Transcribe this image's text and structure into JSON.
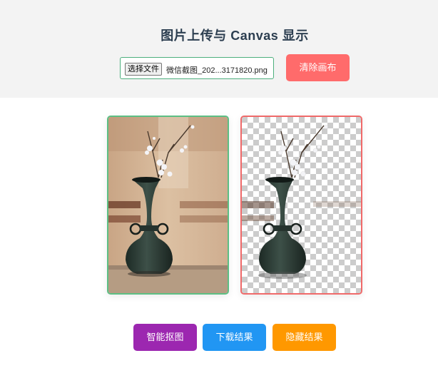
{
  "header": {
    "title": "图片上传与 Canvas 显示",
    "file_button_label": "选择文件",
    "file_name": "微信截图_202...3171820.png",
    "clear_button_label": "清除画布"
  },
  "canvases": {
    "original": {
      "image": "vase-with-branch-photo"
    },
    "result": {
      "image": "vase-with-transparent-background"
    }
  },
  "actions": {
    "matting_label": "智能抠图",
    "download_label": "下载结果",
    "hide_label": "隐藏结果"
  },
  "colors": {
    "file_border": "#4caf7d",
    "clear": "#ff6b6b",
    "original_border": "#5cbf84",
    "result_border": "#f06a6a",
    "matting": "#9c27b0",
    "download": "#2196f3",
    "hide": "#ff9800"
  }
}
